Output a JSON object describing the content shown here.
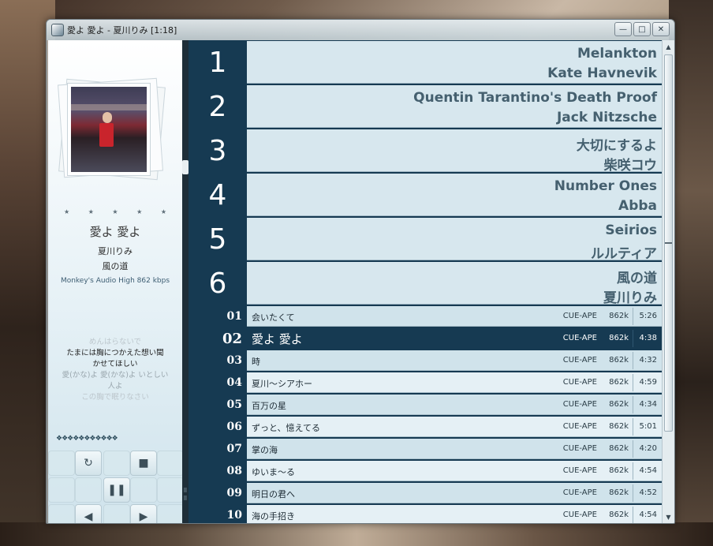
{
  "window": {
    "title": "愛よ 愛よ - 夏川りみ [1:18]",
    "controls": {
      "minimize": "—",
      "maximize": "□",
      "close": "✕"
    }
  },
  "now_playing": {
    "stars": [
      "★",
      "★",
      "★",
      "★",
      "★"
    ],
    "rating_stars": 5,
    "title": "愛よ 愛よ",
    "artist": "夏川りみ",
    "album": "風の道",
    "format": "Monkey's Audio  High  862 kbps",
    "lyrics": [
      {
        "text": "めんはらないで",
        "style": "faded"
      },
      {
        "text": "たまには胸につかえた想い聞",
        "style": "active"
      },
      {
        "text": "かせてほしい",
        "style": "active"
      },
      {
        "text": "愛(かな)よ 愛(かな)よ いとしい",
        "style": "soft"
      },
      {
        "text": "人よ",
        "style": "soft"
      },
      {
        "text": "この胸で眠りなさい",
        "style": "faded"
      }
    ],
    "visualizer_glyphs": "❖❖❖❖❖❖❖❖❖❖❖"
  },
  "transport": {
    "repeat_icon": "↻",
    "stop_icon": "■",
    "pause_icon": "❚❚",
    "prev_icon": "◀",
    "next_icon": "▶"
  },
  "playlists": [
    {
      "number": "1",
      "title": "Melankton",
      "artist": "Kate Havnevik"
    },
    {
      "number": "2",
      "title": "Quentin Tarantino's Death Proof",
      "artist": "Jack Nitzsche"
    },
    {
      "number": "3",
      "title": "大切にするよ",
      "artist": "柴咲コウ"
    },
    {
      "number": "4",
      "title": "Number Ones",
      "artist": "Abba"
    },
    {
      "number": "5",
      "title": "Seirios",
      "artist": "ルルティア"
    },
    {
      "number": "6",
      "title": "風の道",
      "artist": "夏川りみ"
    }
  ],
  "tracks": [
    {
      "number": "01",
      "title": "会いたくて",
      "codec": "CUE-APE",
      "bitrate": "862k",
      "duration": "5:26"
    },
    {
      "number": "02",
      "title": "愛よ 愛よ",
      "codec": "CUE-APE",
      "bitrate": "862k",
      "duration": "4:38",
      "active": true
    },
    {
      "number": "03",
      "title": "時",
      "codec": "CUE-APE",
      "bitrate": "862k",
      "duration": "4:32"
    },
    {
      "number": "04",
      "title": "夏川～シアホー",
      "codec": "CUE-APE",
      "bitrate": "862k",
      "duration": "4:59"
    },
    {
      "number": "05",
      "title": "百万の星",
      "codec": "CUE-APE",
      "bitrate": "862k",
      "duration": "4:34"
    },
    {
      "number": "06",
      "title": "ずっと、憶えてる",
      "codec": "CUE-APE",
      "bitrate": "862k",
      "duration": "5:01"
    },
    {
      "number": "07",
      "title": "掌の海",
      "codec": "CUE-APE",
      "bitrate": "862k",
      "duration": "4:20"
    },
    {
      "number": "08",
      "title": "ゆいま～る",
      "codec": "CUE-APE",
      "bitrate": "862k",
      "duration": "4:54"
    },
    {
      "number": "09",
      "title": "明日の君へ",
      "codec": "CUE-APE",
      "bitrate": "862k",
      "duration": "4:52"
    },
    {
      "number": "10",
      "title": "海の手招き",
      "codec": "CUE-APE",
      "bitrate": "862k",
      "duration": "4:54"
    }
  ],
  "scrollbar": {
    "up_icon": "▲",
    "down_icon": "▼"
  },
  "colors": {
    "list_dark": "#163a52",
    "row_light": "#d0e3eb",
    "row_alt": "#e5f0f5",
    "playlist_text": "#45606f"
  }
}
